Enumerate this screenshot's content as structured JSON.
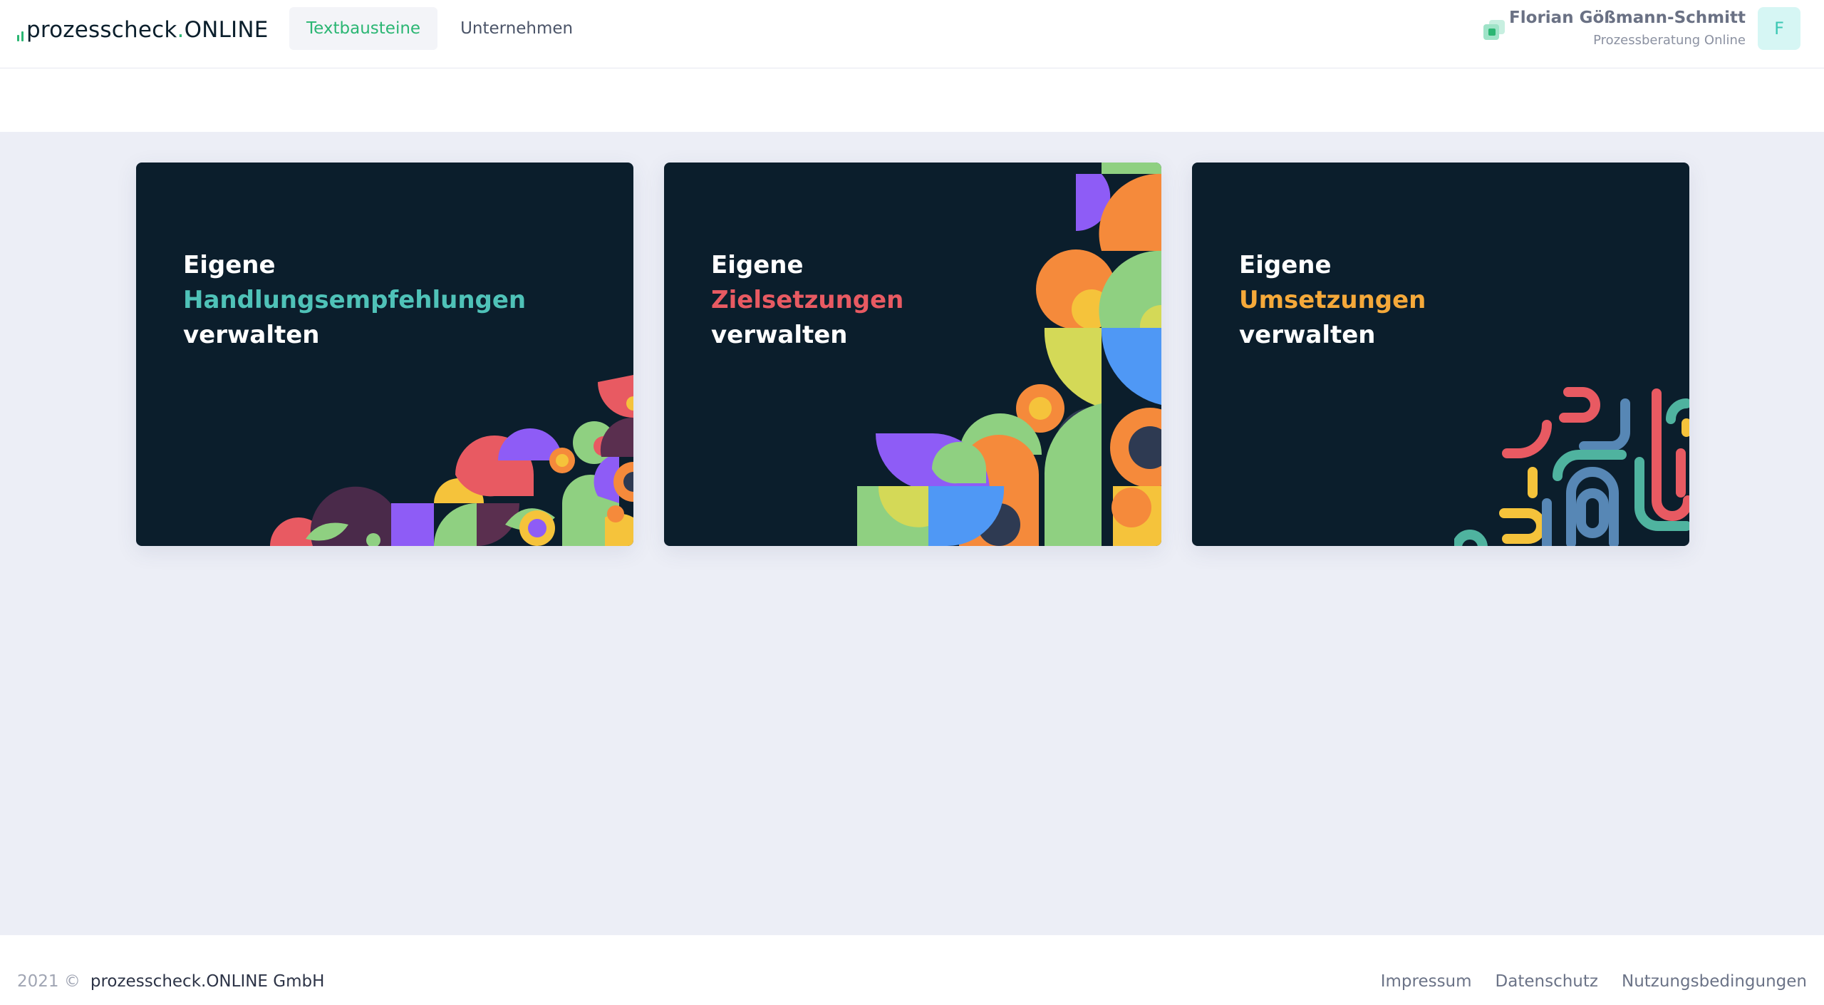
{
  "header": {
    "logo_main": "prozesscheck",
    "logo_dot": ".",
    "logo_suffix": "ONLINE",
    "nav": [
      {
        "label": "Textbausteine",
        "active": true
      },
      {
        "label": "Unternehmen",
        "active": false
      }
    ],
    "user_name": "Florian Gößmann-Schmitt",
    "user_role": "Prozessberatung Online",
    "avatar_initial": "F"
  },
  "cards": [
    {
      "line1": "Eigene",
      "highlight": "Handlungsempfehlungen",
      "line3": "verwalten",
      "accent": "#4fc2b8"
    },
    {
      "line1": "Eigene",
      "highlight": "Zielsetzungen",
      "line3": "verwalten",
      "accent": "#e85a62"
    },
    {
      "line1": "Eigene",
      "highlight": "Umsetzungen",
      "line3": "verwalten",
      "accent": "#f5a93a"
    }
  ],
  "footer": {
    "year": "2021 ©",
    "company": "prozesscheck.ONLINE GmbH",
    "links": [
      "Impressum",
      "Datenschutz",
      "Nutzungsbedingungen"
    ]
  },
  "colors": {
    "brand": "#2bb673",
    "card_bg": "#0b1e2c",
    "page_bg": "#eceef6"
  }
}
